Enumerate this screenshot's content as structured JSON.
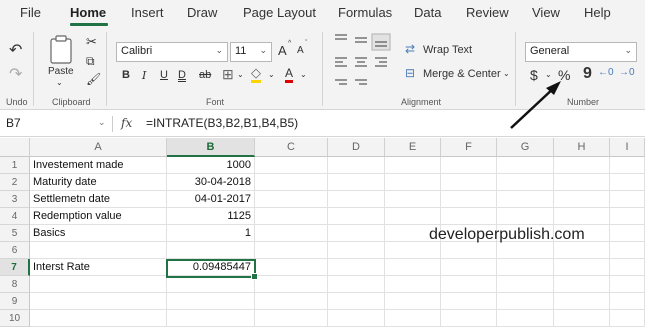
{
  "menu": {
    "tabs": [
      "File",
      "Home",
      "Insert",
      "Draw",
      "Page Layout",
      "Formulas",
      "Data",
      "Review",
      "View",
      "Help"
    ],
    "active": "Home"
  },
  "ribbon": {
    "undo": {
      "label": "Undo"
    },
    "clipboard": {
      "paste_label": "Paste",
      "group_label": "Clipboard"
    },
    "font": {
      "name": "Calibri",
      "size": "11",
      "bold": "B",
      "italic": "I",
      "underline": "U",
      "double_underline": "D",
      "strikethrough": "ab",
      "grow": "A",
      "shrink": "A",
      "font_color": "A",
      "group_label": "Font"
    },
    "alignment": {
      "wrap_text": "Wrap Text",
      "merge_center": "Merge & Center",
      "group_label": "Alignment"
    },
    "number": {
      "format": "General",
      "currency": "$",
      "percent": "%",
      "comma": "9",
      "group_label": "Number"
    }
  },
  "formula_bar": {
    "name_box": "B7",
    "fx": "fx",
    "formula": "=INTRATE(B3,B2,B1,B4,B5)"
  },
  "sheet": {
    "columns": [
      "A",
      "B",
      "C",
      "D",
      "E",
      "F",
      "G",
      "H",
      "I"
    ],
    "selected_column": "B",
    "rows": [
      {
        "num": "1",
        "a": "Investement made",
        "b": "1000"
      },
      {
        "num": "2",
        "a": "Maturity date",
        "b": "30-04-2018"
      },
      {
        "num": "3",
        "a": "Settlemetn date",
        "b": "04-01-2017"
      },
      {
        "num": "4",
        "a": "Redemption value",
        "b": "1125"
      },
      {
        "num": "5",
        "a": "Basics",
        "b": "1"
      },
      {
        "num": "6",
        "a": "",
        "b": ""
      },
      {
        "num": "7",
        "a": "Interst Rate",
        "b": "0.09485447"
      },
      {
        "num": "8",
        "a": "",
        "b": ""
      },
      {
        "num": "9",
        "a": "",
        "b": ""
      },
      {
        "num": "10",
        "a": "",
        "b": ""
      }
    ],
    "selected_row": "7"
  },
  "watermark": "developerpublish.com",
  "colors": {
    "accent": "#217346",
    "ribbon_bg": "#f3f3f3"
  }
}
